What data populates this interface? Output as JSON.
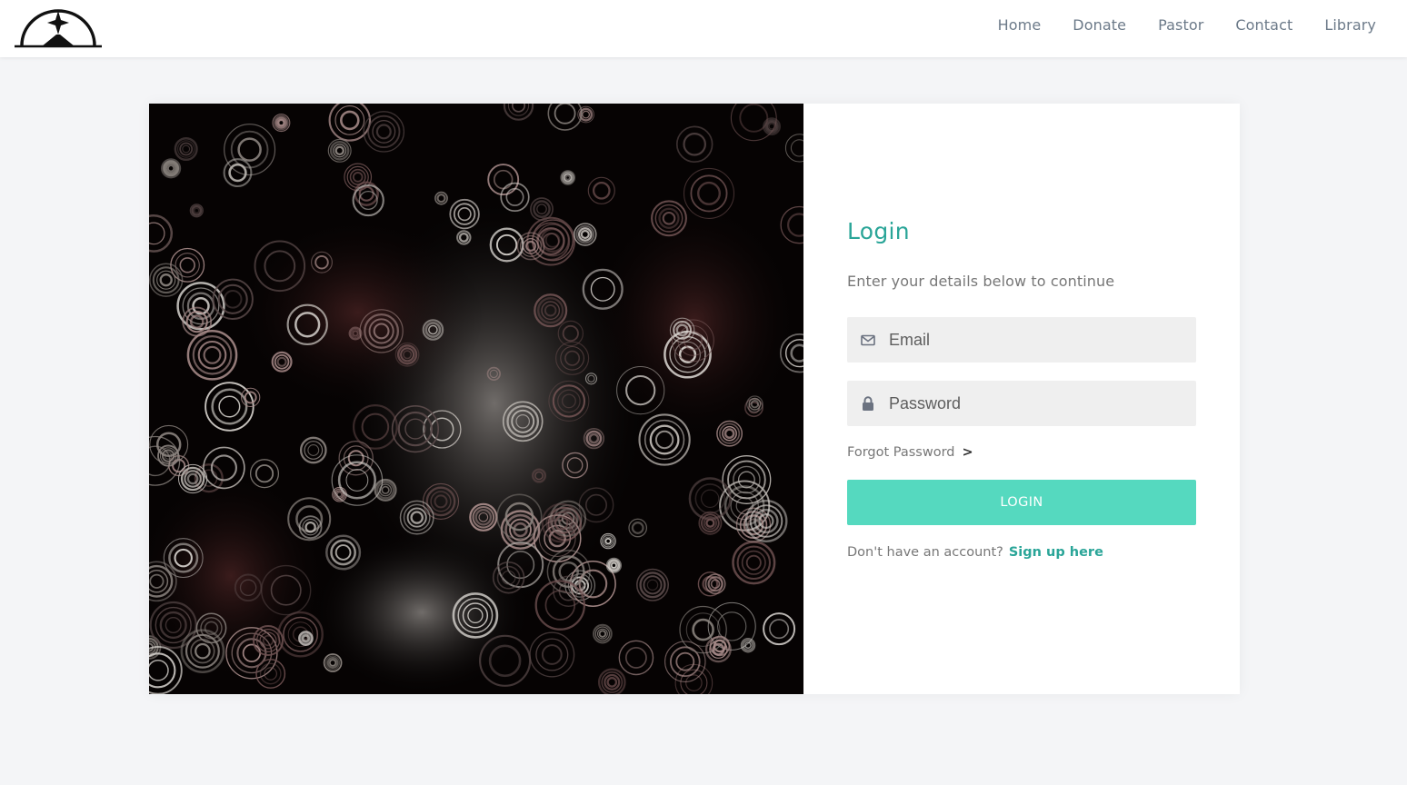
{
  "header": {
    "logo_icon": "church-star-arch-logo",
    "nav": [
      {
        "label": "Home"
      },
      {
        "label": "Donate"
      },
      {
        "label": "Pastor"
      },
      {
        "label": "Contact"
      },
      {
        "label": "Library"
      }
    ]
  },
  "login": {
    "title": "Login",
    "subtitle": "Enter your details below to continue",
    "email_placeholder": "Email",
    "email_icon": "envelope-icon",
    "password_placeholder": "Password",
    "password_icon": "lock-icon",
    "forgot_label": "Forgot Password",
    "forgot_chevron": ">",
    "button_label": "LOGIN",
    "signup_prompt": "Don't have an account?",
    "signup_link": "Sign up here"
  },
  "colors": {
    "accent": "#2aa598",
    "button": "#55d9bf",
    "nav_text": "#6c7a89",
    "background": "#f4f5f7"
  }
}
